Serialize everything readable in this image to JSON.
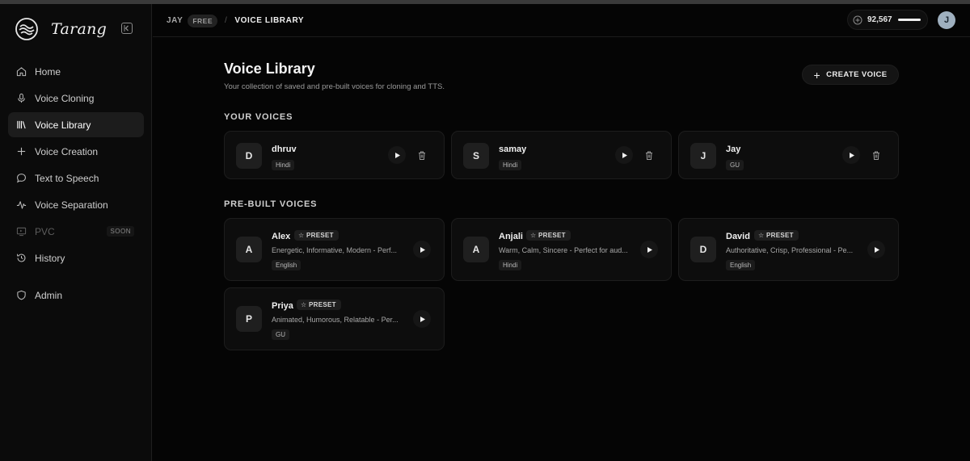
{
  "brand": {
    "name": "Tarang"
  },
  "sidebar": {
    "items": [
      {
        "label": "Home",
        "icon": "home-icon"
      },
      {
        "label": "Voice Cloning",
        "icon": "mic-icon"
      },
      {
        "label": "Voice Library",
        "icon": "library-icon",
        "active": true
      },
      {
        "label": "Voice Creation",
        "icon": "plus-icon"
      },
      {
        "label": "Text to Speech",
        "icon": "speech-bubble-icon"
      },
      {
        "label": "Voice Separation",
        "icon": "waveform-icon"
      },
      {
        "label": "PVC",
        "icon": "screen-icon",
        "badge": "SOON",
        "disabled": true
      },
      {
        "label": "History",
        "icon": "history-icon"
      }
    ],
    "admin": {
      "label": "Admin",
      "icon": "shield-icon"
    }
  },
  "header": {
    "user": "JAY",
    "plan": "FREE",
    "separator": "/",
    "page": "VOICE LIBRARY",
    "credits": "92,567",
    "avatar_initial": "J"
  },
  "main": {
    "title": "Voice Library",
    "subtitle": "Your collection of saved and pre-built voices for cloning and TTS.",
    "create_button": "CREATE VOICE",
    "your_voices_title": "YOUR VOICES",
    "prebuilt_title": "PRE-BUILT VOICES",
    "preset_label": "PRESET",
    "your_voices": [
      {
        "initial": "D",
        "name": "dhruv",
        "language": "Hindi"
      },
      {
        "initial": "S",
        "name": "samay",
        "language": "Hindi"
      },
      {
        "initial": "J",
        "name": "Jay",
        "language": "GU"
      }
    ],
    "prebuilt_voices": [
      {
        "initial": "A",
        "name": "Alex",
        "description": "Energetic, Informative, Modern - Perf...",
        "language": "English"
      },
      {
        "initial": "A",
        "name": "Anjali",
        "description": "Warm, Calm, Sincere - Perfect for aud...",
        "language": "Hindi"
      },
      {
        "initial": "D",
        "name": "David",
        "description": "Authoritative, Crisp, Professional - Pe...",
        "language": "English"
      },
      {
        "initial": "P",
        "name": "Priya",
        "description": "Animated, Humorous, Relatable - Per...",
        "language": "GU"
      }
    ]
  },
  "colors": {
    "background": "#050505",
    "sidebar": "#0b0b0b",
    "card": "#0d0d0d",
    "active": "#1c1c1c",
    "avatar": "#9fb0bf"
  }
}
